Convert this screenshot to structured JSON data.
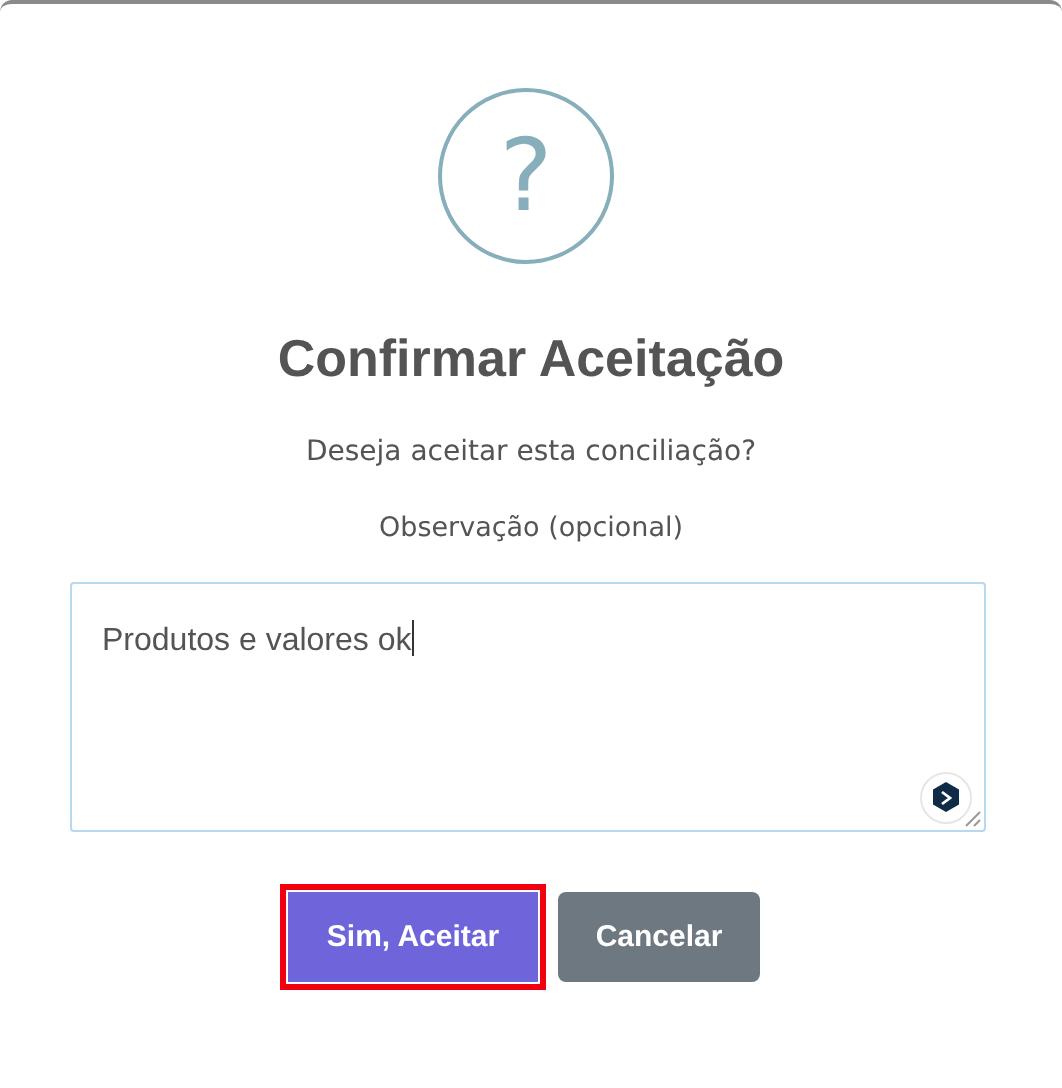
{
  "dialog": {
    "icon": "?",
    "title": "Confirmar Aceitação",
    "message": "Deseja aceitar esta conciliação?",
    "field": {
      "label": "Observação (opcional)",
      "value": "Produtos e valores ok"
    },
    "buttons": [
      {
        "label": "Sim, Aceitar",
        "kind": "primary",
        "highlighted": true
      },
      {
        "label": "Cancelar",
        "kind": "secondary",
        "highlighted": false
      }
    ]
  }
}
